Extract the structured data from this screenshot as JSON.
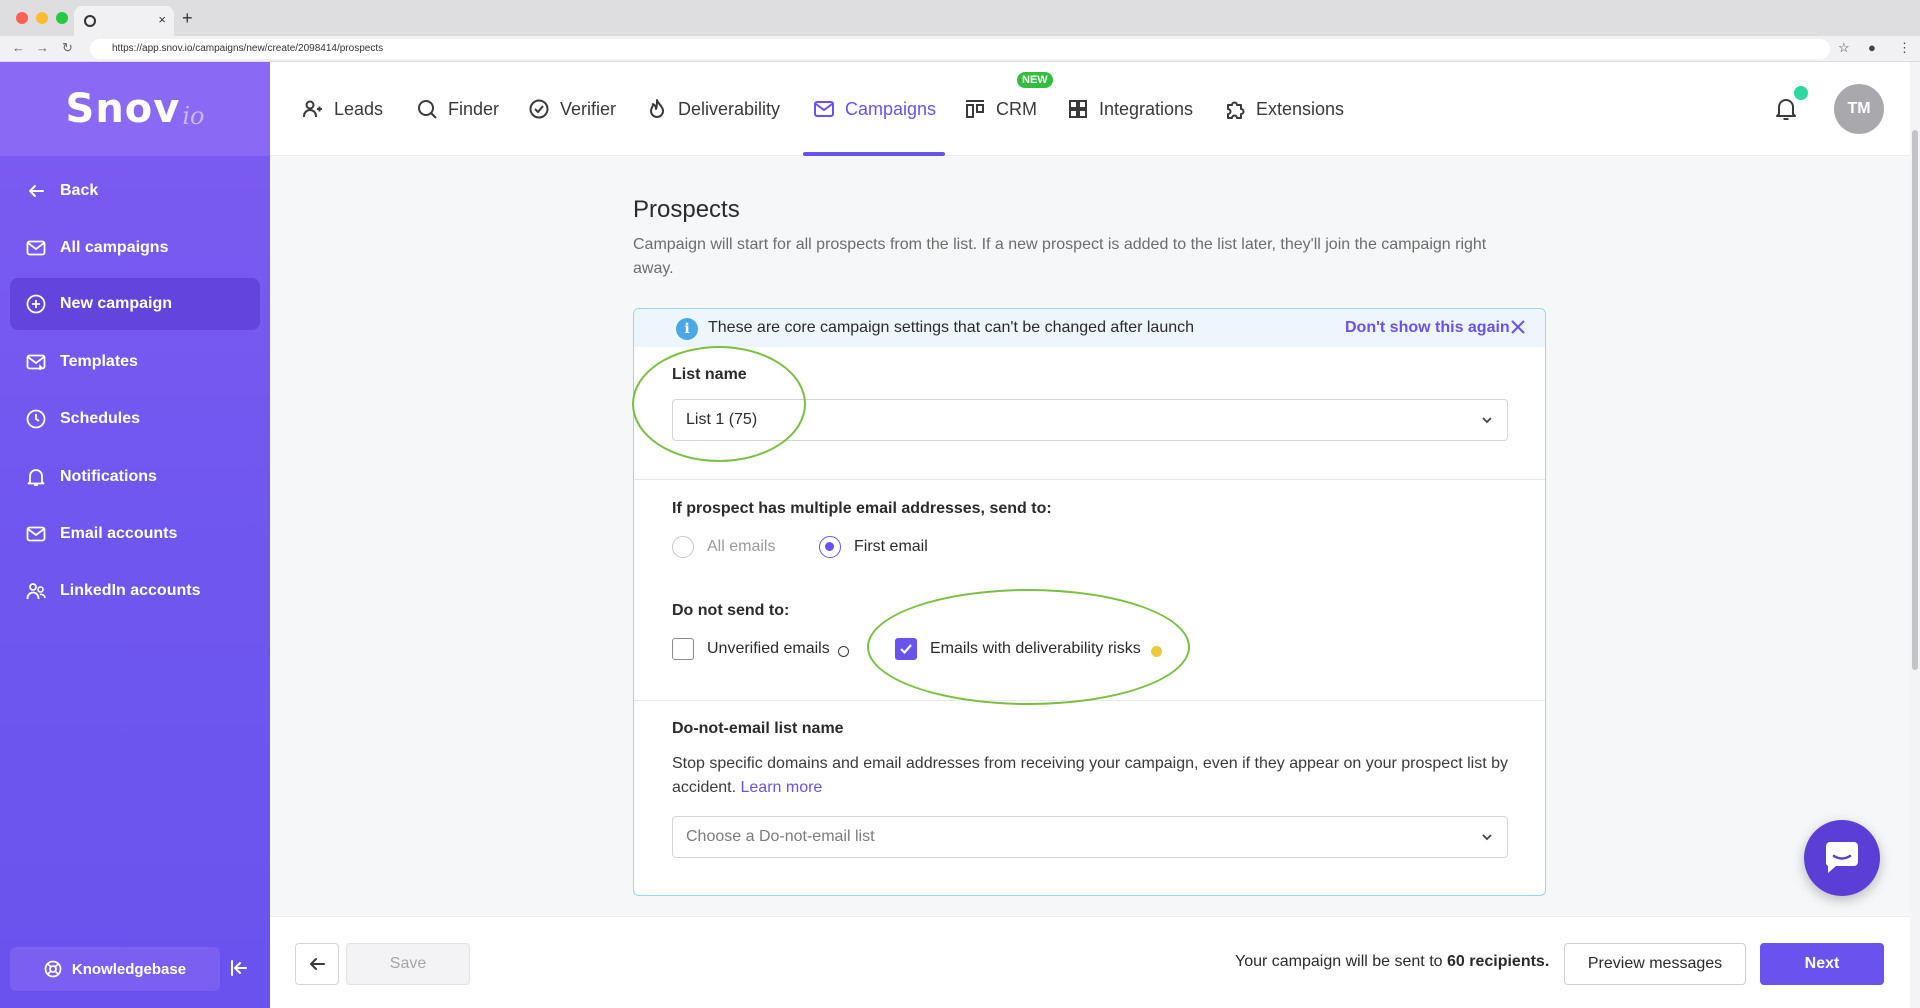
{
  "browser": {
    "url": "https://app.snov.io/campaigns/new/create/2098414/prospects",
    "tab_close": "×",
    "new_tab": "+"
  },
  "brand": {
    "name": "Snov",
    "suffix": "io"
  },
  "sidebar": {
    "items": [
      {
        "label": "Back",
        "icon": "arrow-left-icon"
      },
      {
        "label": "All campaigns",
        "icon": "mail-icon"
      },
      {
        "label": "New campaign",
        "icon": "plus-circle-icon",
        "active": true
      },
      {
        "label": "Templates",
        "icon": "mail-template-icon"
      },
      {
        "label": "Schedules",
        "icon": "clock-icon"
      },
      {
        "label": "Notifications",
        "icon": "bell-icon"
      },
      {
        "label": "Email accounts",
        "icon": "mail-icon"
      },
      {
        "label": "LinkedIn accounts",
        "icon": "users-icon"
      }
    ],
    "knowledgebase": "Knowledgebase"
  },
  "topnav": {
    "items": [
      {
        "label": "Leads",
        "icon": "users-icon"
      },
      {
        "label": "Finder",
        "icon": "search-icon"
      },
      {
        "label": "Verifier",
        "icon": "check-circle-icon"
      },
      {
        "label": "Deliverability",
        "icon": "flame-icon"
      },
      {
        "label": "Campaigns",
        "icon": "mail-icon",
        "active": true
      },
      {
        "label": "CRM",
        "icon": "crm-icon"
      },
      {
        "label": "Integrations",
        "icon": "grid-icon"
      },
      {
        "label": "Extensions",
        "icon": "puzzle-icon"
      }
    ],
    "new_badge": "NEW",
    "avatar_initials": "TM"
  },
  "page": {
    "title": "Prospects",
    "description": "Campaign will start for all prospects from the list. If a new prospect is added to the list later, they'll join the campaign right away."
  },
  "info": {
    "icon_glyph": "i",
    "text": "These are core campaign settings that can't be changed after launch",
    "dismiss": "Don't show this again"
  },
  "list_section": {
    "label": "List name",
    "selected": "List 1 (75)"
  },
  "multiple_emails": {
    "label": "If prospect has multiple email addresses, send to:",
    "options": [
      {
        "label": "All emails",
        "selected": false
      },
      {
        "label": "First email",
        "selected": true
      }
    ]
  },
  "do_not_send": {
    "label": "Do not send to:",
    "options": [
      {
        "label": "Unverified emails",
        "checked": false
      },
      {
        "label": "Emails with deliverability risks",
        "checked": true
      }
    ]
  },
  "dne_section": {
    "label": "Do-not-email list name",
    "description": "Stop specific domains and email addresses from receiving your campaign, even if they appear on your prospect list by accident.",
    "learn_more": "Learn more",
    "placeholder": "Choose a Do-not-email list"
  },
  "footer": {
    "save": "Save",
    "send_prefix": "Your campaign will be sent to",
    "recipients": "60 recipients.",
    "preview": "Preview messages",
    "next": "Next"
  },
  "colors": {
    "accent": "#6a52ee",
    "sidebar": "#7d5cf2",
    "highlight_ring": "#7bc043",
    "warning_dot": "#f0c93a",
    "online_dot": "#2ed6a0"
  }
}
